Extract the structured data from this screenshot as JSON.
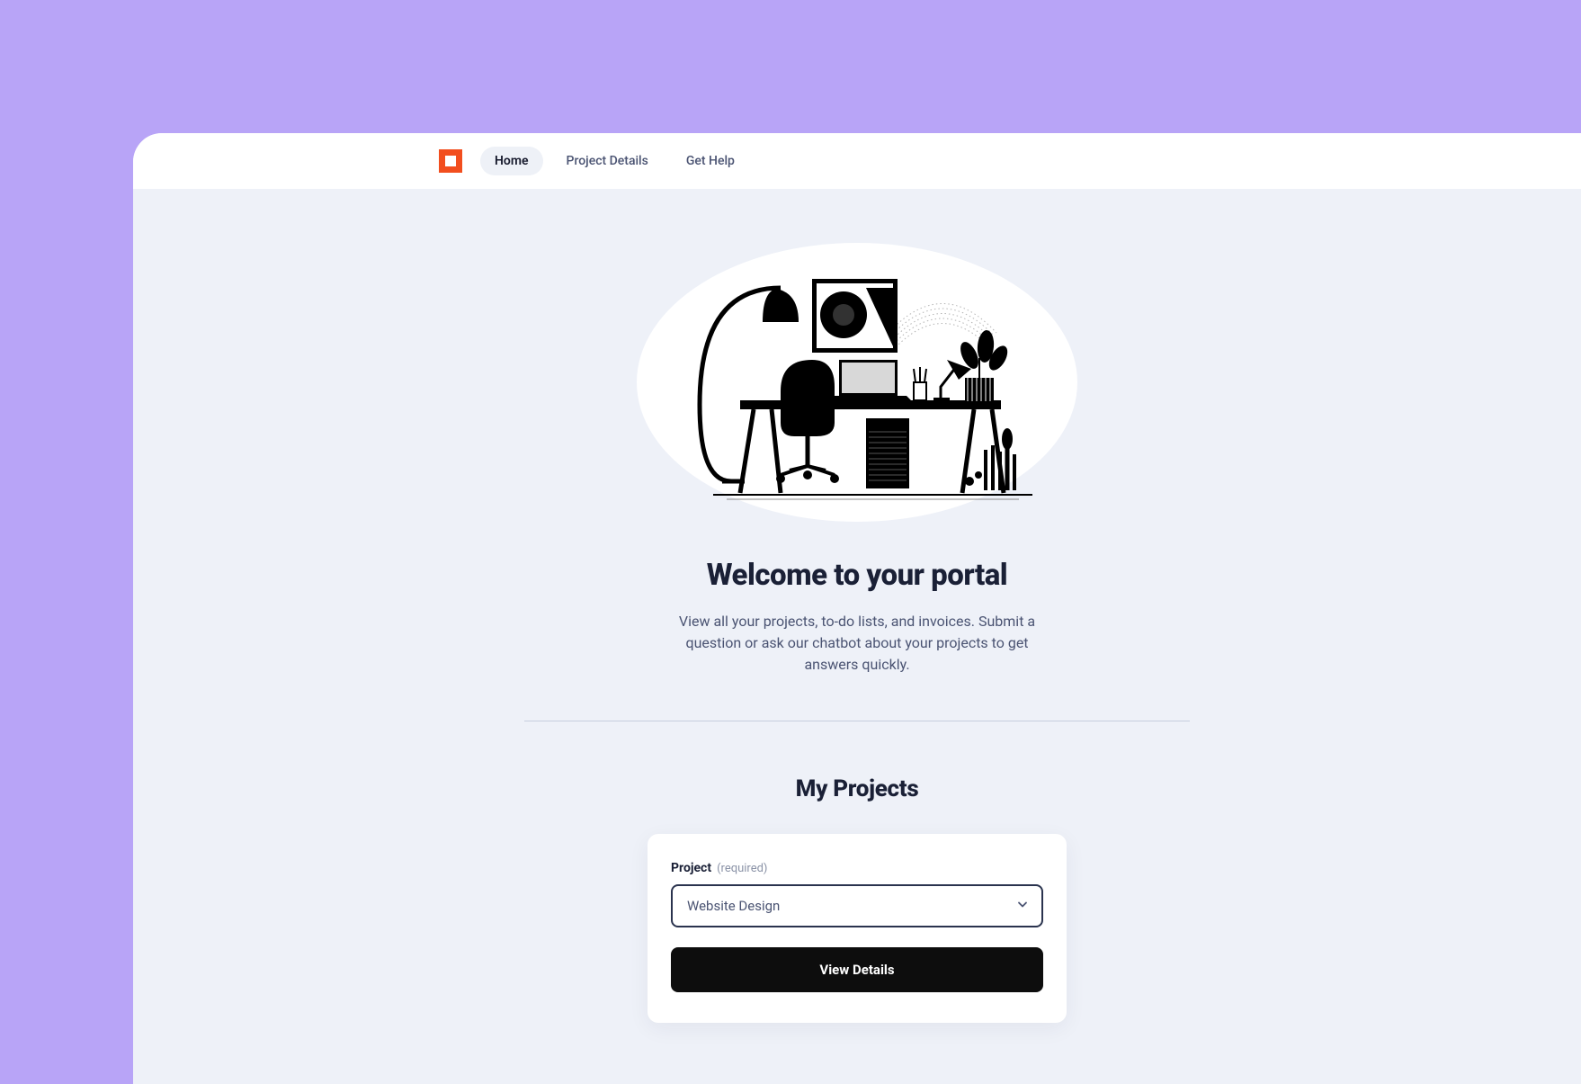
{
  "nav": {
    "items": [
      {
        "label": "Home",
        "active": true
      },
      {
        "label": "Project Details",
        "active": false
      },
      {
        "label": "Get Help",
        "active": false
      }
    ]
  },
  "hero": {
    "title": "Welcome to your portal",
    "description": "View all your projects, to-do lists, and invoices. Submit a question or ask our chatbot about your projects to get answers quickly."
  },
  "projects": {
    "section_title": "My Projects",
    "field_label": "Project",
    "required_text": "(required)",
    "selected_value": "Website Design",
    "view_details_label": "View Details"
  }
}
